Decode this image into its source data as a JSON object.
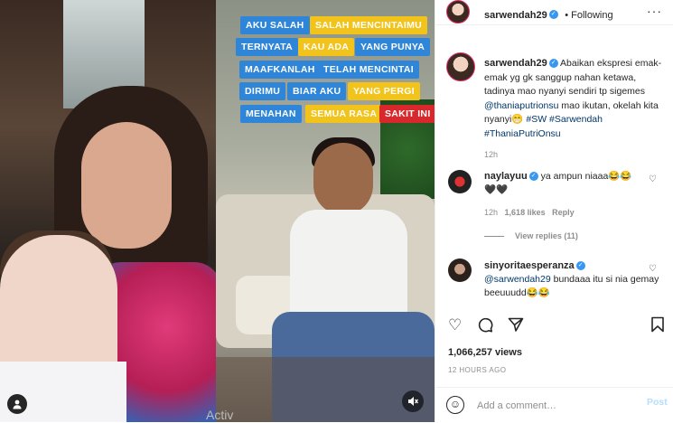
{
  "post": {
    "author": "sarwendah29",
    "follow_state": "Following",
    "caption_username": "sarwendah29",
    "caption_text": "Abaikan ekspresi emak-emak yg gk sanggup nahan ketawa, tadinya mao nyanyi sendiri tp sigemes",
    "caption_mention": "@thaniaputrionsu",
    "caption_text2": "mao ikutan, okelah kita nyanyi😁",
    "caption_tags": "#SW #Sarwendah #ThaniaPutriOnsu",
    "caption_time": "12h",
    "views": "1,066,257 views",
    "posted_ago": "12 HOURS AGO"
  },
  "video": {
    "lyrics": [
      {
        "text": "AKU SALAH",
        "color": "blue"
      },
      {
        "text": "SALAH MENCINTAIMU",
        "color": "yellow"
      },
      {
        "text": "TERNYATA",
        "color": "blue"
      },
      {
        "text": "KAU ADA",
        "color": "yellow"
      },
      {
        "text": "YANG PUNYA",
        "color": "blue"
      },
      {
        "text": "MAAFKANLAH",
        "color": "blue"
      },
      {
        "text": "TELAH MENCINTAI",
        "color": "blue"
      },
      {
        "text": "DIRIMU",
        "color": "blue"
      },
      {
        "text": "BIAR AKU",
        "color": "blue"
      },
      {
        "text": "YANG PERGI",
        "color": "yellow"
      },
      {
        "text": "MENAHAN",
        "color": "blue"
      },
      {
        "text": "SEMUA RASA",
        "color": "yellow"
      },
      {
        "text": "SAKIT INI",
        "color": "red"
      }
    ],
    "mute_icon": "muted-speaker-icon",
    "tag_icon": "user-tag-icon"
  },
  "comments": [
    {
      "username": "naylayuu",
      "verified": true,
      "text": "ya ampun niaaa😂😂\n🖤🖤",
      "time": "12h",
      "likes": "1,618 likes",
      "reply": "Reply",
      "view_replies": "View replies (11)"
    },
    {
      "username": "sinyoritaesperanza",
      "verified": true,
      "mention": "@sarwendah29",
      "text": "bundaaa itu si nia gemay beeuuudd😂😂"
    }
  ],
  "actions": {
    "like_icon": "heart-icon",
    "comment_icon": "comment-icon",
    "share_icon": "share-icon",
    "save_icon": "bookmark-icon"
  },
  "composer": {
    "placeholder": "Add a comment…",
    "post_label": "Post",
    "emoji_icon": "smile-icon"
  },
  "overlay": {
    "activate_text": "Activ"
  },
  "colors": {
    "lyric_blue": "#2f86d8",
    "lyric_yellow": "#f2c31a",
    "lyric_red": "#d8282b",
    "link": "#00376b",
    "verified": "#3897f0"
  }
}
